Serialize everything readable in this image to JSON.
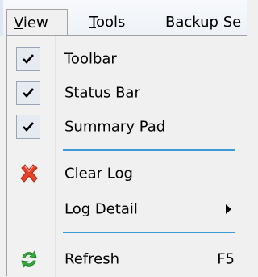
{
  "menubar": {
    "view": "View",
    "view_mnemonic": "V",
    "view_rest": "iew",
    "tools_mnemonic": "T",
    "tools_rest": "ools",
    "backup_label": "Backup Se"
  },
  "view_menu": {
    "toolbar": {
      "label": "Toolbar",
      "checked": true
    },
    "status_bar": {
      "label": "Status Bar",
      "checked": true
    },
    "summary_pad": {
      "label": "Summary Pad",
      "checked": true
    },
    "clear_log": {
      "label": "Clear Log",
      "icon": "red-x-icon"
    },
    "log_detail": {
      "label": "Log Detail",
      "has_submenu": true
    },
    "refresh": {
      "label": "Refresh",
      "shortcut": "F5",
      "icon": "refresh-arrows-icon"
    }
  },
  "colors": {
    "separator": "#3c9ad6",
    "clear_icon": "#e8432a",
    "refresh_icon": "#2fae38"
  }
}
